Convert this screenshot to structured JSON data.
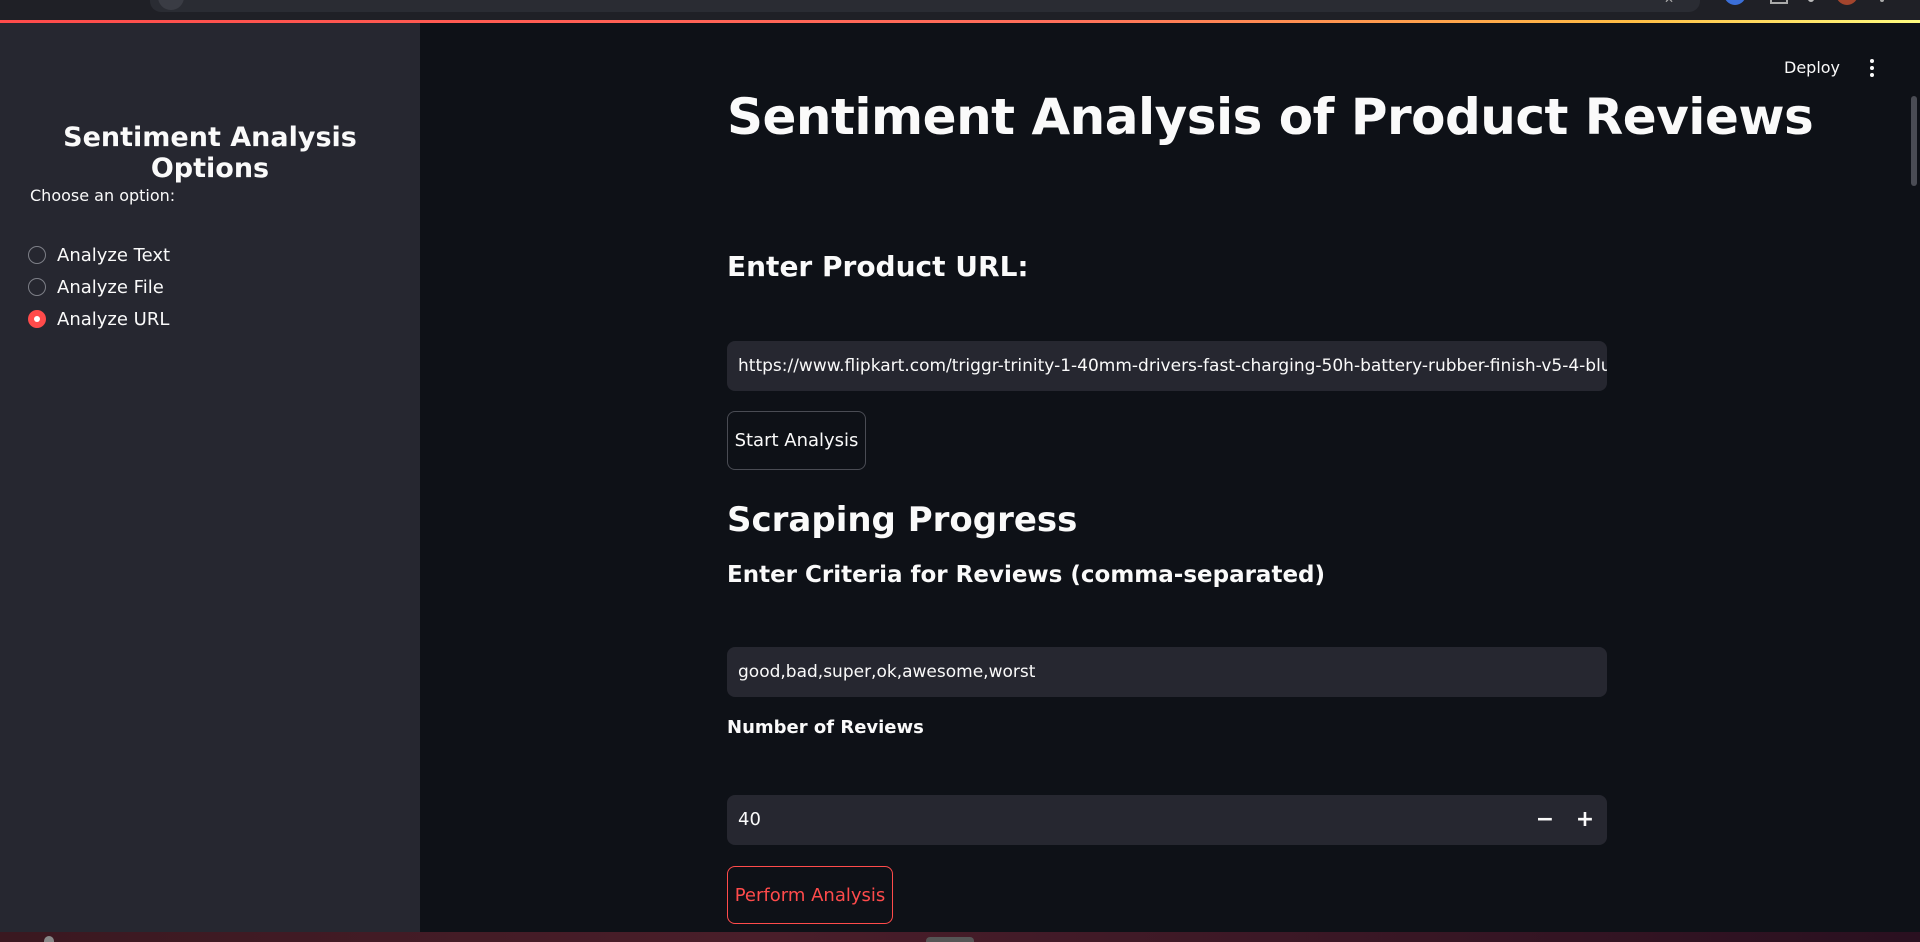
{
  "browser": {
    "icons": [
      "tab-favicon-icon",
      "bookmark-star-icon",
      "extension-icon",
      "profile-icon",
      "menu-icon"
    ]
  },
  "sidebar": {
    "title": "Sentiment Analysis Options",
    "radio_label": "Choose an option:",
    "options": [
      {
        "label": "Analyze Text",
        "selected": false
      },
      {
        "label": "Analyze File",
        "selected": false
      },
      {
        "label": "Analyze URL",
        "selected": true
      }
    ]
  },
  "header": {
    "deploy_label": "Deploy",
    "menu_icon": "kebab-menu-icon"
  },
  "main": {
    "title": "Sentiment Analysis of Product Reviews",
    "url_heading": "Enter Product URL:",
    "url_value": "https://www.flipkart.com/triggr-trinity-1-40mm-drivers-fast-charging-50h-battery-rubber-finish-v5-4-blu",
    "start_button": "Start Analysis",
    "scraping_heading": "Scraping Progress",
    "criteria_heading": "Enter Criteria for Reviews (comma-separated)",
    "criteria_value": "good,bad,super,ok,awesome,worst",
    "reviews_label": "Number of Reviews",
    "reviews_value": "40",
    "stepper_minus": "−",
    "stepper_plus": "+",
    "perform_button": "Perform Analysis"
  },
  "colors": {
    "accent": "#ff4b4b",
    "background": "#0e1117",
    "sidebar": "#262730",
    "input": "#262730",
    "text": "#fafafa"
  }
}
